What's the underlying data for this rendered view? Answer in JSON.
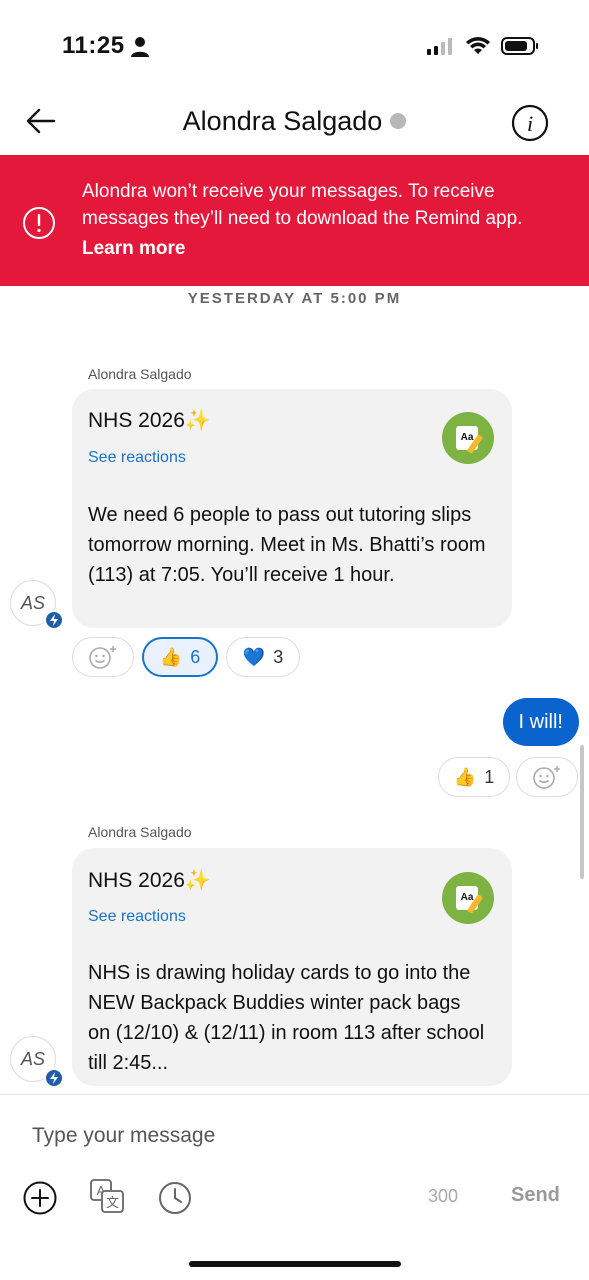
{
  "status_bar": {
    "time": "11:25"
  },
  "header": {
    "title": "Alondra Salgado"
  },
  "banner": {
    "text": "Alondra won’t receive your messages. To receive messages they’ll need to download the Remind app.",
    "link": "Learn more",
    "color": "#e4183b"
  },
  "date_divider": "YESTERDAY AT 5:00 PM",
  "messages": [
    {
      "sender": "Alondra Salgado",
      "title": "NHS 2026✨",
      "see_reactions": "See reactions",
      "app_icon_text": "Aa",
      "body": "We need 6 people to pass out tutoring slips tomorrow morning. Meet in Ms. Bhatti’s room (113) at 7:05. You’ll receive 1 hour.",
      "avatar": "AS",
      "reactions": [
        {
          "emoji": "👍",
          "count": "6",
          "active": true
        },
        {
          "emoji": "💙",
          "count": "3",
          "active": false
        }
      ]
    },
    {
      "sender": "Alondra Salgado",
      "title": "NHS 2026✨",
      "see_reactions": "See reactions",
      "app_icon_text": "Aa",
      "body": "NHS is drawing holiday cards to go into the NEW Backpack Buddies winter pack bags on (12/10) & (12/11) in room 113 after school till 2:45...",
      "avatar": "AS"
    }
  ],
  "my_message": {
    "text": "I will!",
    "reactions": [
      {
        "emoji": "👍",
        "count": "1"
      }
    ]
  },
  "composer": {
    "placeholder": "Type your message",
    "char_count": "300",
    "send_label": "Send"
  },
  "colors": {
    "accent": "#0b63ce",
    "link": "#1a73c8",
    "app_badge": "#7cb342"
  }
}
